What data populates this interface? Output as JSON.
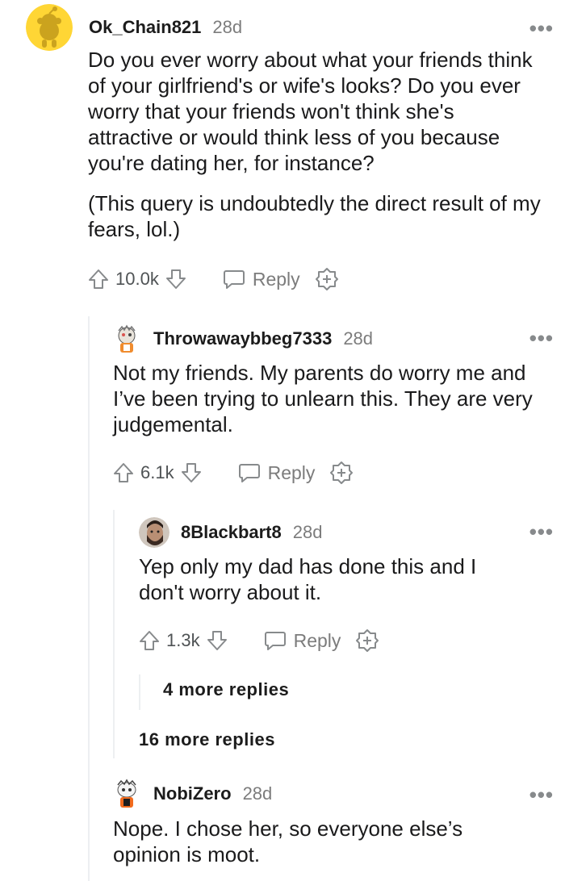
{
  "comments": [
    {
      "username": "Ok_Chain821",
      "time": "28d",
      "body": [
        "Do you ever worry about what your friends think of your girlfriend's or wife's looks? Do you ever worry that your friends won't think she's attractive or would think less of you because you're dating her, for instance?",
        "(This query is undoubtedly the direct result of my fears, lol.)"
      ],
      "votes": "10.0k",
      "reply_label": "Reply",
      "avatar_color": "#FFD635"
    },
    {
      "username": "Throwawaybbeg7333",
      "time": "28d",
      "body": [
        "Not my friends. My parents do worry me and I’ve been trying to unlearn this. They are very judgemental."
      ],
      "votes": "6.1k",
      "reply_label": "Reply"
    },
    {
      "username": "8Blackbart8",
      "time": "28d",
      "body": [
        "Yep only my dad has done this and I don't worry about it."
      ],
      "votes": "1.3k",
      "reply_label": "Reply"
    },
    {
      "username": "NobiZero",
      "time": "28d",
      "body": [
        "Nope. I chose her, so everyone else’s opinion is moot."
      ]
    }
  ],
  "more_replies_nested": "4 more replies",
  "more_replies_outer": "16 more replies",
  "icons": {
    "more": "more-options-icon",
    "upvote": "upvote-arrow-icon",
    "downvote": "downvote-arrow-icon",
    "reply": "speech-bubble-icon",
    "award": "award-plus-icon"
  }
}
